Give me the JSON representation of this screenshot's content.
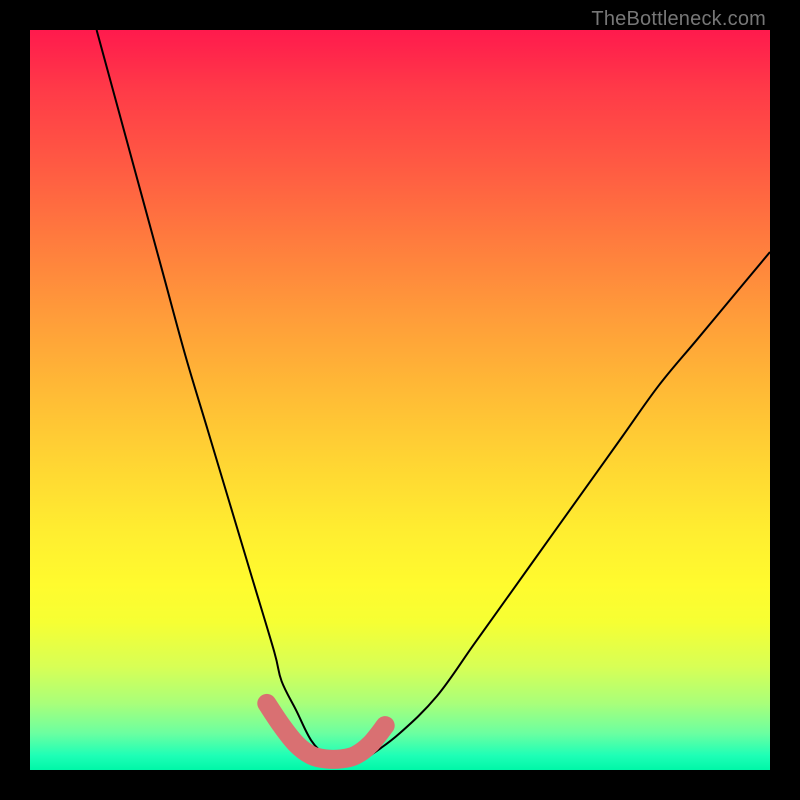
{
  "watermark": "TheBottleneck.com",
  "colors": {
    "frame": "#000000",
    "curve": "#000000",
    "bottom_arc": "#d97072",
    "gradient_stops": [
      {
        "pos": 0.0,
        "color": "#ff1a4d"
      },
      {
        "pos": 0.08,
        "color": "#ff3a48"
      },
      {
        "pos": 0.18,
        "color": "#ff5943"
      },
      {
        "pos": 0.28,
        "color": "#ff7a3e"
      },
      {
        "pos": 0.38,
        "color": "#ff9a3a"
      },
      {
        "pos": 0.48,
        "color": "#ffb836"
      },
      {
        "pos": 0.58,
        "color": "#ffd433"
      },
      {
        "pos": 0.68,
        "color": "#ffee30"
      },
      {
        "pos": 0.75,
        "color": "#fffb2e"
      },
      {
        "pos": 0.8,
        "color": "#f6ff33"
      },
      {
        "pos": 0.86,
        "color": "#d8ff55"
      },
      {
        "pos": 0.91,
        "color": "#a9ff7a"
      },
      {
        "pos": 0.95,
        "color": "#6cffa0"
      },
      {
        "pos": 0.98,
        "color": "#1fffb6"
      },
      {
        "pos": 1.0,
        "color": "#00f7a8"
      }
    ]
  },
  "chart_data": {
    "type": "line",
    "title": "",
    "xlabel": "",
    "ylabel": "",
    "xlim": [
      0,
      100
    ],
    "ylim": [
      0,
      100
    ],
    "series": [
      {
        "name": "bottleneck-curve",
        "x": [
          9,
          12,
          15,
          18,
          21,
          24,
          27,
          30,
          33,
          34,
          36,
          38,
          40,
          42,
          44,
          46,
          50,
          55,
          60,
          65,
          70,
          75,
          80,
          85,
          90,
          95,
          100
        ],
        "y": [
          100,
          89,
          78,
          67,
          56,
          46,
          36,
          26,
          16,
          12,
          8,
          4,
          2,
          1,
          1,
          2,
          5,
          10,
          17,
          24,
          31,
          38,
          45,
          52,
          58,
          64,
          70
        ]
      }
    ],
    "highlight": {
      "name": "optimal-zone",
      "x": [
        32,
        34,
        36,
        38,
        40,
        42,
        44,
        46,
        48
      ],
      "y": [
        9,
        6,
        3.5,
        2,
        1.5,
        1.5,
        2,
        3.5,
        6
      ]
    }
  }
}
